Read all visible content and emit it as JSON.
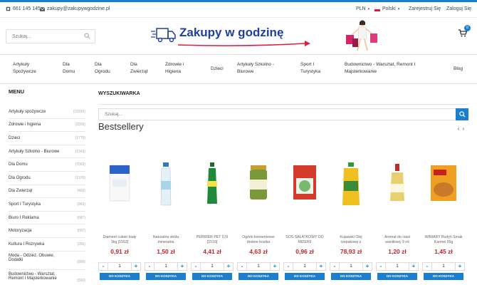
{
  "topbar": {
    "phone": "661 145 145",
    "email": "zakupy@zakupywgodzine.pl",
    "currency": "PLN",
    "language": "Polski",
    "register": "Zarejestruj Się",
    "login": "Zaloguj Się"
  },
  "header": {
    "search_placeholder": "Szukaj...",
    "logo_text": "Zakupy w godzinę",
    "cart_count": "0"
  },
  "nav": [
    {
      "line1": "Artykuły",
      "line2": "Spożywcze"
    },
    {
      "line1": "Dla",
      "line2": "Domu"
    },
    {
      "line1": "Dla",
      "line2": "Ogrodu"
    },
    {
      "line1": "Dla",
      "line2": "Zwierząt"
    },
    {
      "line1": "Zdrowie i",
      "line2": "Higiena"
    },
    {
      "line1": "Dzieci",
      "line2": ""
    },
    {
      "line1": "Artykuły Szkolno -",
      "line2": "Biurowe"
    },
    {
      "line1": "Sport I",
      "line2": "Turystyka"
    },
    {
      "line1": "Budownictwo - Warsztat, Remont I",
      "line2": "Majsterkowanie"
    },
    {
      "line1": "Blog",
      "line2": ""
    }
  ],
  "sidebar": {
    "title": "MENU",
    "items": [
      {
        "label": "Artykuły spożywcze",
        "count": "(10330)"
      },
      {
        "label": "Zdrowie i higiena",
        "count": "(2203)"
      },
      {
        "label": "Dzieci",
        "count": "(1770)"
      },
      {
        "label": "Artykuły Szkolno - Biurowe",
        "count": "(1343)"
      },
      {
        "label": "Dla Domu",
        "count": "(7003)"
      },
      {
        "label": "Dla Ogrodu",
        "count": "(1370)"
      },
      {
        "label": "Dla Zwierząt",
        "count": "(403)"
      },
      {
        "label": "Sport I Turystyka",
        "count": "(993)"
      },
      {
        "label": "Biuro I Reklama",
        "count": "(687)"
      },
      {
        "label": "Motoryzacja",
        "count": "(697)"
      },
      {
        "label": "Kultura I Rozrywka",
        "count": "(256)"
      },
      {
        "label": "Moda - Odzież, Obuwie, Dodatki",
        "count": "(899)"
      },
      {
        "label": "Budownictwo - Warsztat, Remont I Majsterkowanie",
        "count": "(550)"
      }
    ]
  },
  "main": {
    "section_title": "WYSZUKIWARKA",
    "search_placeholder": "Szukaj...",
    "bestsellers_title": "Bestsellery"
  },
  "products": [
    {
      "name": "Diament cukier biały 1kg [1553]",
      "price": "0,91 zł",
      "qty": "1",
      "add_label": "DO KOSZYKA",
      "color": "#2a64c8"
    },
    {
      "name": "Naturalna woda mineralna",
      "price": "1,50 zł",
      "qty": "1",
      "add_label": "DO KOSZYKA",
      "color": "#a8d4e8"
    },
    {
      "name": "PERRIER PET 0,5l [1519]",
      "price": "4,41 zł",
      "qty": "1",
      "add_label": "DO KOSZYKA",
      "color": "#1f8a3a"
    },
    {
      "name": "Ogórki konserwowe drobne kostka",
      "price": "4,63 zł",
      "qty": "1",
      "add_label": "DO KOSZYKA",
      "color": "#7a9a3a"
    },
    {
      "name": "SOS SAŁATKOWY DO MIZERII",
      "price": "0,96 zł",
      "qty": "1",
      "add_label": "DO KOSZYKA",
      "color": "#d43a2a"
    },
    {
      "name": "Kujawski Olej rzepakowy z",
      "price": "78,93 zł",
      "qty": "1",
      "add_label": "DO KOSZYKA",
      "color": "#f0c020"
    },
    {
      "name": "Aromat do ciast waniliowy 9 ml",
      "price": "1,20 zł",
      "qty": "1",
      "add_label": "DO KOSZYKA",
      "color": "#e8d070"
    },
    {
      "name": "WINIARY Budyń Smak Karmel 55g",
      "price": "1,45 zł",
      "qty": "1",
      "add_label": "DO KOSZYKA",
      "color": "#c9792a"
    }
  ],
  "colors": {
    "accent": "#1a7fd0",
    "price": "#c0262c",
    "logo": "#1f3fa0",
    "arrow": "#e01d3c"
  }
}
